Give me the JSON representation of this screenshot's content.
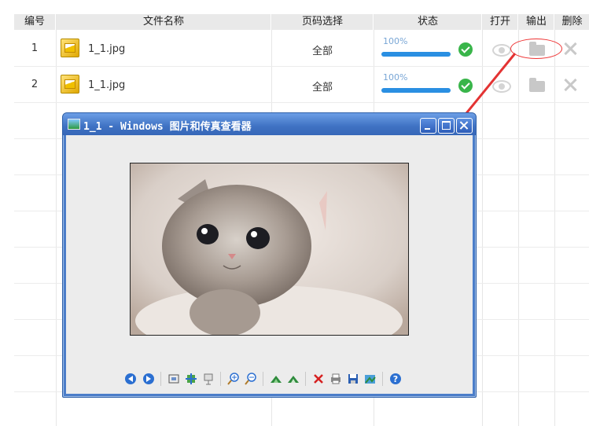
{
  "table": {
    "headers": {
      "index": "编号",
      "filename": "文件名称",
      "pages": "页码选择",
      "status": "状态",
      "open": "打开",
      "output": "输出",
      "delete": "删除"
    },
    "rows": [
      {
        "index": "1",
        "filename": "1_1.jpg",
        "pages": "全部",
        "progress_label": "100%",
        "progress": 1.0
      },
      {
        "index": "2",
        "filename": "1_1.jpg",
        "pages": "全部",
        "progress_label": "100%",
        "progress": 1.0
      }
    ]
  },
  "viewer": {
    "title": "1_1 - Windows 图片和传真查看器",
    "toolbar": [
      "previous-image-icon",
      "next-image-icon",
      "best-fit-icon",
      "actual-size-icon",
      "slideshow-icon",
      "zoom-in-icon",
      "zoom-out-icon",
      "rotate-clockwise-icon",
      "rotate-counterclockwise-icon",
      "delete-icon",
      "print-icon",
      "save-icon",
      "edit-icon",
      "help-icon"
    ]
  },
  "colors": {
    "accent": "#2a8fe2",
    "success": "#39b54a",
    "annotation": "#e33333",
    "window_title": "#3f72c3"
  }
}
